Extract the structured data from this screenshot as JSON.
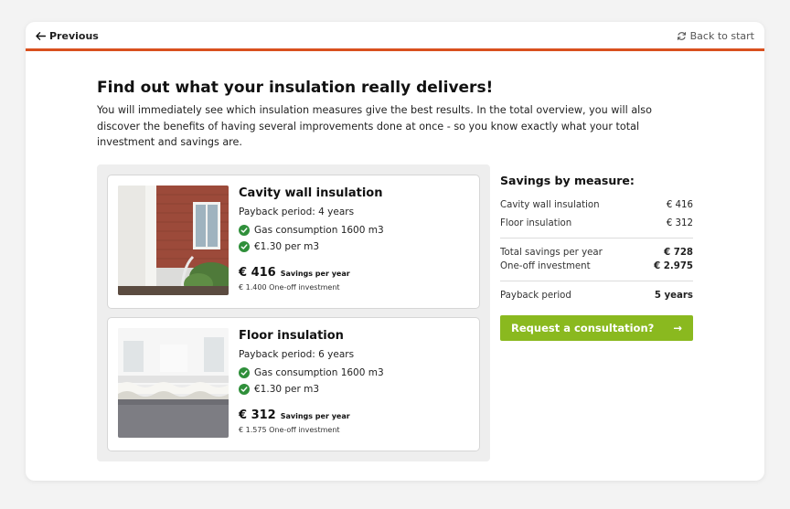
{
  "nav": {
    "previous_label": "Previous",
    "back_label": "Back to start"
  },
  "page": {
    "title": "Find out what your insulation really delivers!",
    "intro": "You will immediately see which insulation measures give the best results. In the total overview, you will also discover the benefits of having several improvements done at once - so you know exactly what your total investment and savings are."
  },
  "measures": [
    {
      "name": "Cavity wall insulation",
      "payback": "Payback period:  4 years",
      "checks": [
        "Gas consumption 1600 m3",
        "€1.30 per m3"
      ],
      "savings_amount": "€ 416",
      "savings_label": "Savings per year",
      "investment": "€ 1.400 One-off investment"
    },
    {
      "name": "Floor insulation",
      "payback": "Payback period: 6 years",
      "checks": [
        "Gas consumption 1600 m3",
        "€1.30 per m3"
      ],
      "savings_amount": "€ 312",
      "savings_label": "Savings per year",
      "investment": "€ 1.575 One-off investment"
    }
  ],
  "summary": {
    "title": "Savings by measure:",
    "items": [
      {
        "label": "Cavity wall insulation",
        "value": "€ 416"
      },
      {
        "label": "Floor insulation",
        "value": "€ 312"
      }
    ],
    "total_savings": {
      "label": "Total savings per year",
      "value": "€ 728"
    },
    "investment": {
      "label": "One-off investment",
      "value": "€ 2.975"
    },
    "payback": {
      "label": "Payback period",
      "value": "5 years"
    }
  },
  "cta": {
    "label": "Request a consultation?",
    "arrow": "→"
  },
  "colors": {
    "accent_orange": "#d9501e",
    "cta_green": "#8ab91f",
    "check_green": "#2f8f3a"
  }
}
